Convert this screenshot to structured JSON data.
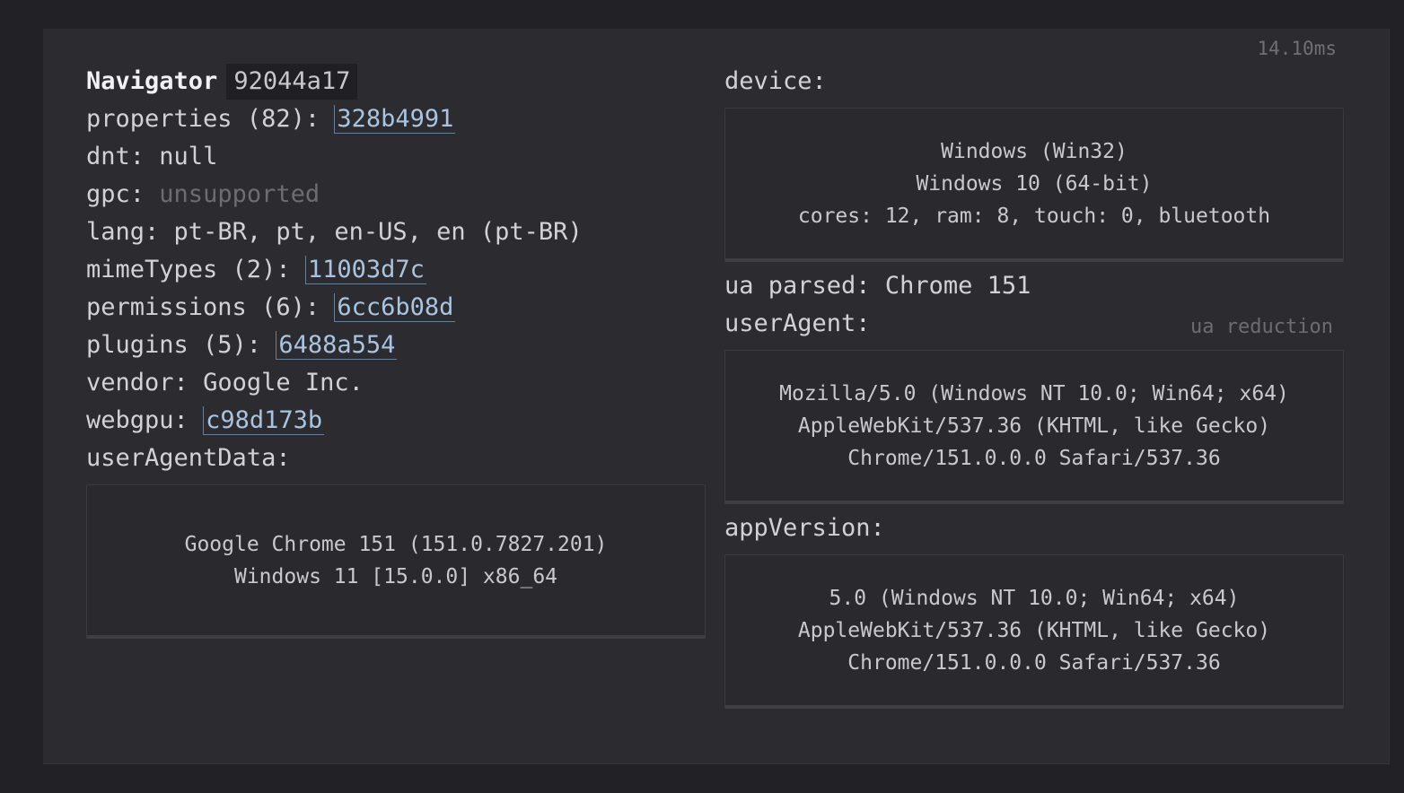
{
  "perf": "14.10ms",
  "navigator": {
    "title": "Navigator",
    "hash": "92044a17",
    "properties_label": "properties (82):",
    "properties_hash": "328b4991",
    "dnt_label": "dnt:",
    "dnt_value": "null",
    "gpc_label": "gpc:",
    "gpc_value": "unsupported",
    "lang_label": "lang:",
    "lang_value": "pt-BR, pt, en-US, en (pt-BR)",
    "mimetypes_label": "mimeTypes (2):",
    "mimetypes_hash": "11003d7c",
    "permissions_label": "permissions (6):",
    "permissions_hash": "6cc6b08d",
    "plugins_label": "plugins (5):",
    "plugins_hash": "6488a554",
    "vendor_label": "vendor:",
    "vendor_value": "Google Inc.",
    "webgpu_label": "webgpu:",
    "webgpu_hash": "c98d173b",
    "uadata_label": "userAgentData:",
    "uadata_lines": [
      "Google Chrome 151 (151.0.7827.201)",
      "Windows 11 [15.0.0] x86_64"
    ]
  },
  "device": {
    "label": "device:",
    "lines": [
      "Windows (Win32)",
      "Windows 10 (64-bit)",
      "cores: 12, ram: 8, touch: 0, bluetooth"
    ]
  },
  "ua_parsed": {
    "label": "ua parsed:",
    "value": "Chrome 151"
  },
  "user_agent": {
    "label": "userAgent:",
    "note": "ua reduction",
    "lines": [
      "Mozilla/5.0 (Windows NT 10.0; Win64; x64)",
      "AppleWebKit/537.36 (KHTML, like Gecko)",
      "Chrome/151.0.0.0 Safari/537.36"
    ]
  },
  "app_version": {
    "label": "appVersion:",
    "lines": [
      "5.0 (Windows NT 10.0; Win64; x64)",
      "AppleWebKit/537.36 (KHTML, like Gecko)",
      "Chrome/151.0.0.0 Safari/537.36"
    ]
  }
}
